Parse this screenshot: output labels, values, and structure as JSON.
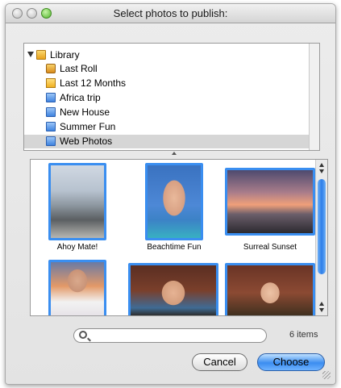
{
  "window": {
    "title": "Select photos to publish:"
  },
  "tree": {
    "items": [
      {
        "label": "Library",
        "icon": "library-folder-icon",
        "level": 0,
        "expanded": true
      },
      {
        "label": "Last Roll",
        "icon": "last-roll-icon",
        "level": 1
      },
      {
        "label": "Last 12 Months",
        "icon": "calendar-folder-icon",
        "level": 1
      },
      {
        "label": "Africa trip",
        "icon": "album-icon",
        "level": 1
      },
      {
        "label": "New House",
        "icon": "album-icon",
        "level": 1
      },
      {
        "label": "Summer Fun",
        "icon": "album-icon",
        "level": 1
      },
      {
        "label": "Web Photos",
        "icon": "album-icon",
        "level": 1,
        "selected": true
      }
    ]
  },
  "photos": [
    {
      "caption": "Ahoy Mate!",
      "selected": true
    },
    {
      "caption": "Beachtime Fun",
      "selected": true
    },
    {
      "caption": "Surreal Sunset",
      "selected": true
    },
    {
      "caption": "",
      "selected": true
    },
    {
      "caption": "",
      "selected": true
    },
    {
      "caption": "",
      "selected": true
    }
  ],
  "search": {
    "value": "",
    "placeholder": ""
  },
  "status": {
    "item_count": "6 items"
  },
  "buttons": {
    "cancel": "Cancel",
    "choose": "Choose"
  },
  "colors": {
    "selection_blue": "#3a8ef0",
    "primary_button": "#3b8df0"
  }
}
